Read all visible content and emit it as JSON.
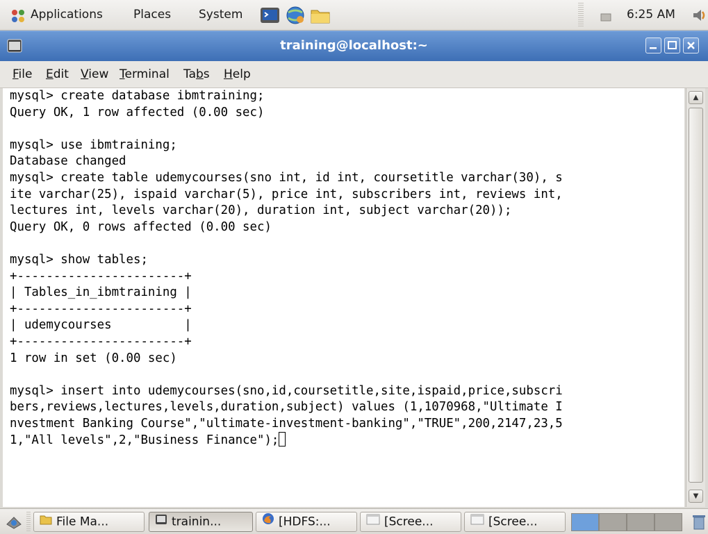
{
  "top_panel": {
    "menus": [
      "Applications",
      "Places",
      "System"
    ],
    "launchers": [
      "terminal-launcher-icon",
      "network-globe-icon",
      "folder-icon"
    ],
    "clock": "6:25 AM",
    "icons": [
      "applications-icon",
      "notification-icon",
      "volume-icon"
    ]
  },
  "window": {
    "title": "training@localhost:~",
    "menu": [
      {
        "pre": "",
        "u": "F",
        "post": "ile"
      },
      {
        "pre": "",
        "u": "E",
        "post": "dit"
      },
      {
        "pre": "",
        "u": "V",
        "post": "iew"
      },
      {
        "pre": "",
        "u": "T",
        "post": "erminal"
      },
      {
        "pre": "Ta",
        "u": "b",
        "post": "s"
      },
      {
        "pre": "",
        "u": "H",
        "post": "elp"
      }
    ]
  },
  "terminal": {
    "lines": [
      "mysql> create database ibmtraining;",
      "Query OK, 1 row affected (0.00 sec)",
      "",
      "mysql> use ibmtraining;",
      "Database changed",
      "mysql> create table udemycourses(sno int, id int, coursetitle varchar(30), s",
      "ite varchar(25), ispaid varchar(5), price int, subscribers int, reviews int,",
      "lectures int, levels varchar(20), duration int, subject varchar(20));",
      "Query OK, 0 rows affected (0.00 sec)",
      "",
      "mysql> show tables;",
      "+-----------------------+",
      "| Tables_in_ibmtraining |",
      "+-----------------------+",
      "| udemycourses          |",
      "+-----------------------+",
      "1 row in set (0.00 sec)",
      "",
      "mysql> insert into udemycourses(sno,id,coursetitle,site,ispaid,price,subscri",
      "bers,reviews,lectures,levels,duration,subject) values (1,1070968,\"Ultimate I",
      "nvestment Banking Course\",\"ultimate-investment-banking\",\"TRUE\",200,2147,23,5",
      "1,\"All levels\",2,\"Business Finance\");"
    ]
  },
  "taskbar": {
    "items": [
      {
        "label": "File Ma...",
        "icon": "folder-icon"
      },
      {
        "label": "trainin...",
        "icon": "terminal-icon"
      },
      {
        "label": "[HDFS:...",
        "icon": "firefox-icon"
      },
      {
        "label": "[Scree...",
        "icon": "image-viewer-icon"
      },
      {
        "label": "[Scree...",
        "icon": "image-viewer-icon"
      }
    ]
  }
}
